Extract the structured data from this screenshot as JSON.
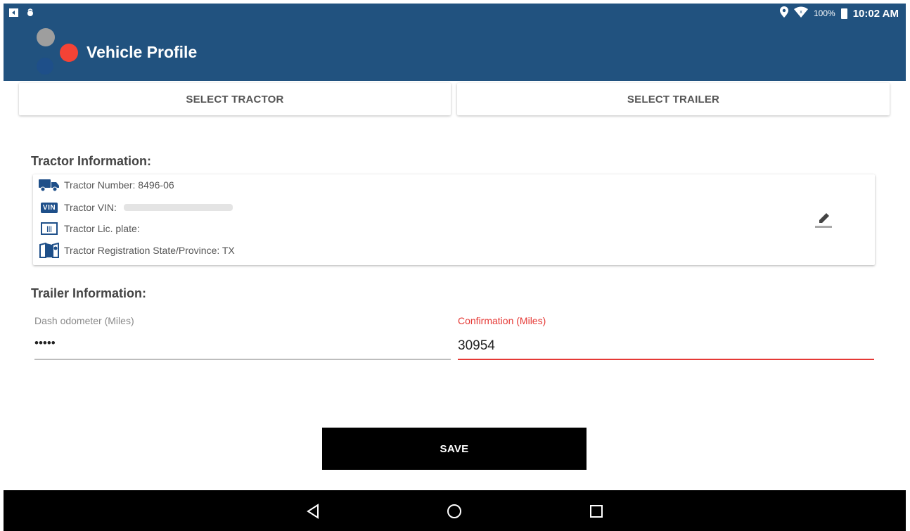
{
  "status_bar": {
    "battery_percent": "100%",
    "time": "10:02 AM"
  },
  "app_bar": {
    "title": "Vehicle Profile"
  },
  "selectors": {
    "tractor_label": "SELECT TRACTOR",
    "trailer_label": "SELECT TRAILER"
  },
  "tractor_info": {
    "heading": "Tractor Information:",
    "number": "Tractor Number: 8496-06",
    "vin_label": "Tractor VIN:",
    "vin_badge": "VIN",
    "plate_label": "Tractor Lic. plate:",
    "plate_icon_text": "|||",
    "state": "Tractor Registration State/Province: TX"
  },
  "trailer_info": {
    "heading": "Trailer Information:"
  },
  "form": {
    "dash_odometer": {
      "label": "Dash odometer (Miles)",
      "value": "•••••"
    },
    "confirmation": {
      "label": "Confirmation (Miles)",
      "value": "30954"
    }
  },
  "save_label": "SAVE",
  "colors": {
    "app_bar": "#21527f",
    "accent_error": "#e53935",
    "icon_blue": "#1e4f89",
    "logo_gray": "#9e9e9e",
    "logo_red": "#f44336"
  }
}
